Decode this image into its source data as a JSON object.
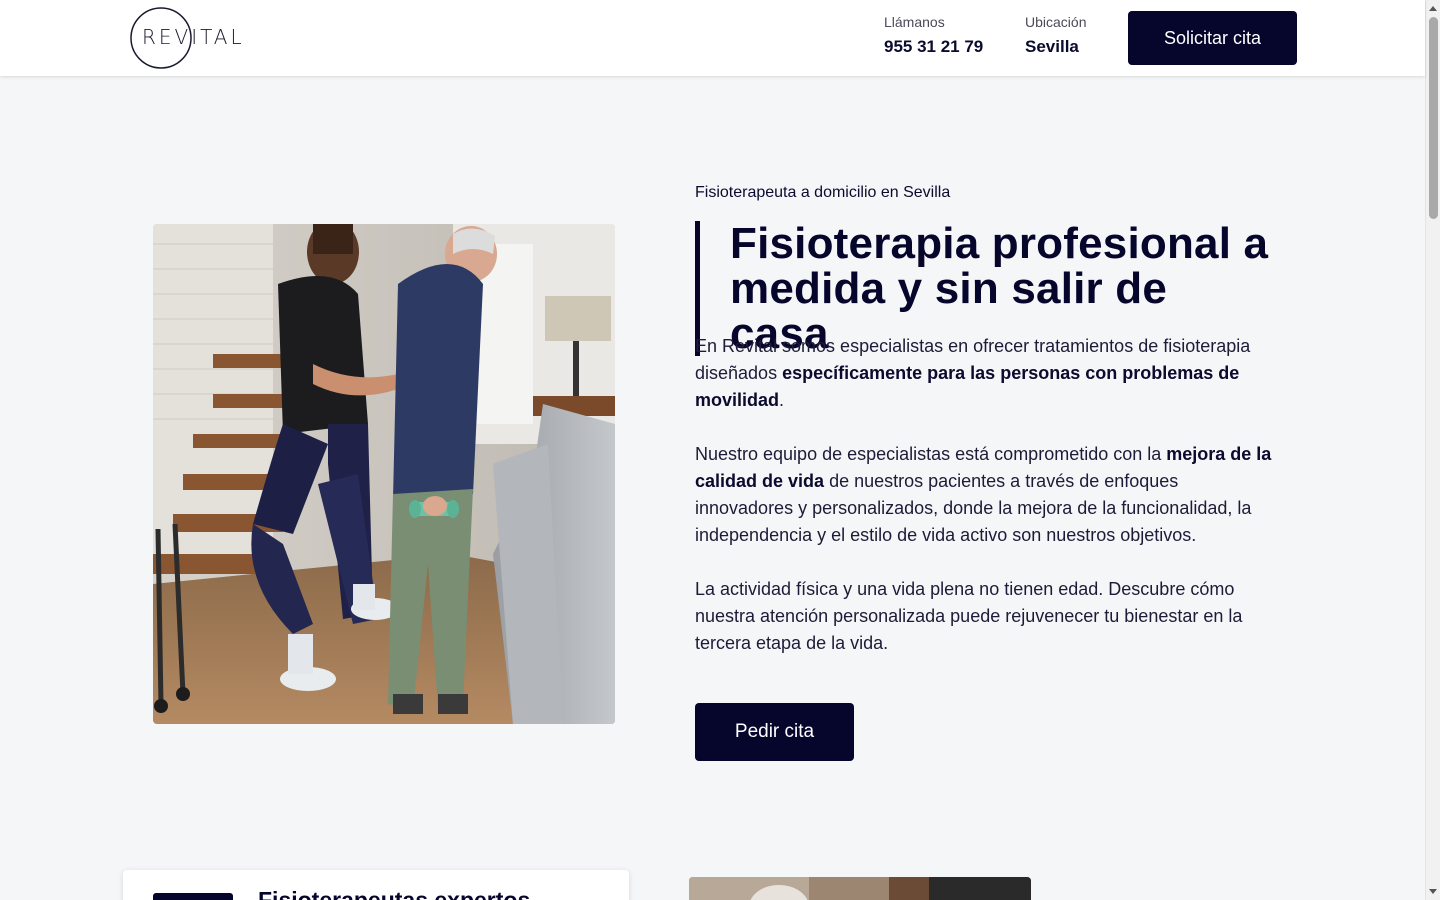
{
  "header": {
    "logo_text": "REVITAL",
    "phone_label": "Llámanos",
    "phone_value": "955 31 21 79",
    "location_label": "Ubicación",
    "location_value": "Sevilla",
    "cta_label": "Solicitar cita"
  },
  "hero": {
    "eyebrow": "Fisioterapeuta a domicilio en Sevilla",
    "title": "Fisioterapia profesional a medida y sin salir de casa",
    "p1_a": "En Revital somos especialistas en ofrecer tratamientos de fisioterapia diseñados ",
    "p1_b": "específicamente para las personas con problemas de movilidad",
    "p1_c": ".",
    "p2_a": "Nuestro equipo de especialistas está comprometido con la ",
    "p2_b": "mejora de la calidad de vida",
    "p2_c": " de nuestros pacientes a través de enfoques innovadores y personalizados, donde la mejora de la funcionalidad, la independencia y el estilo de vida activo son nuestros objetivos.",
    "p3": "La actividad física y una vida plena no tienen edad. Descubre cómo nuestra atención personalizada puede rejuvenecer tu bienestar en la tercera etapa de la vida.",
    "cta_label": "Pedir cita"
  },
  "next_section": {
    "card_title": "Fisioterapeutas expertos"
  },
  "colors": {
    "brand": "#06052c",
    "background": "#f5f6f8"
  }
}
